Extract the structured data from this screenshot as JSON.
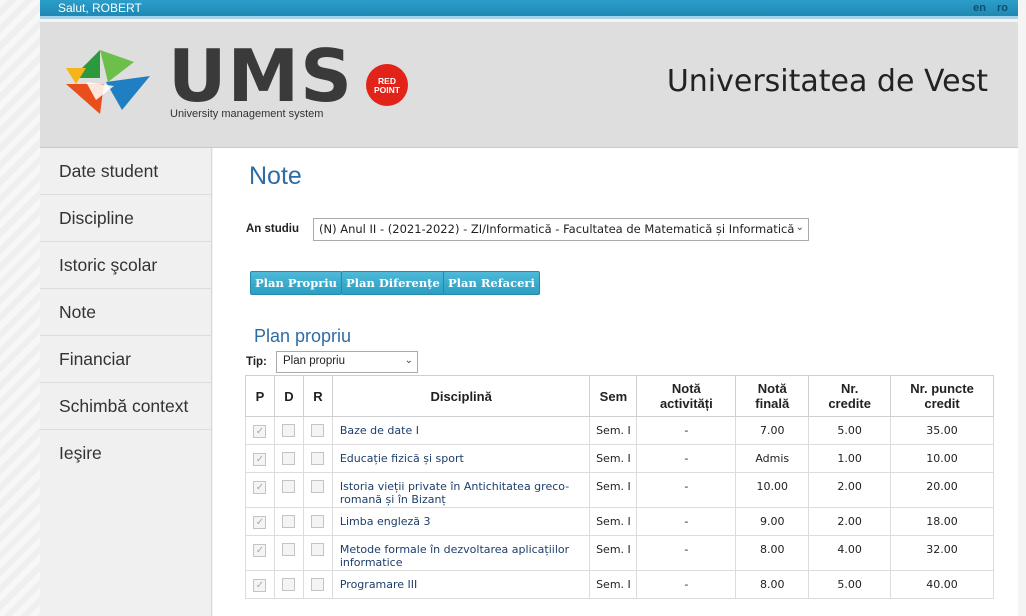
{
  "topbar": {
    "greeting": "Salut, ROBERT",
    "lang_en": "en",
    "lang_ro": "ro"
  },
  "header": {
    "logo_text": "UMS",
    "logo_subtitle": "University management system",
    "badge_line1": "RED",
    "badge_line2": "POINT",
    "university": "Universitatea de Vest"
  },
  "sidebar": {
    "items": [
      {
        "label": "Date student"
      },
      {
        "label": "Discipline"
      },
      {
        "label": "Istoric şcolar"
      },
      {
        "label": "Note"
      },
      {
        "label": "Financiar"
      },
      {
        "label": "Schimbă context"
      },
      {
        "label": "Ieşire"
      }
    ]
  },
  "main": {
    "title": "Note",
    "year_label": "An studiu",
    "year_value": "(N) Anul II - (2021-2022) - ZI/Informatică - Facultatea de Matematică și Informatică",
    "buttons": {
      "plan_propriu": "Plan Propriu",
      "plan_diferente": "Plan Diferențe",
      "plan_refaceri": "Plan Refaceri"
    },
    "section_title": "Plan propriu",
    "tip_label": "Tip:",
    "tip_value": "Plan propriu",
    "table": {
      "headers": {
        "p": "P",
        "d": "D",
        "r": "R",
        "disciplina": "Disciplină",
        "sem": "Sem",
        "nota_activitati_1": "Notă",
        "nota_activitati_2": "activități",
        "nota_finala_1": "Notă",
        "nota_finala_2": "finală",
        "credite_1": "Nr.",
        "credite_2": "credite",
        "puncte_1": "Nr. puncte",
        "puncte_2": "credit"
      },
      "rows": [
        {
          "disciplina": "Baze de date I",
          "sem": "Sem. I",
          "nota_activitati": "-",
          "nota_finala": "7.00",
          "credite": "5.00",
          "puncte": "35.00",
          "p": true
        },
        {
          "disciplina": "Educație fizică și sport",
          "sem": "Sem. I",
          "nota_activitati": "-",
          "nota_finala": "Admis",
          "credite": "1.00",
          "puncte": "10.00",
          "p": true
        },
        {
          "disciplina": "Istoria vieții private în Antichitatea greco-romană și în Bizanț",
          "sem": "Sem. I",
          "nota_activitati": "-",
          "nota_finala": "10.00",
          "credite": "2.00",
          "puncte": "20.00",
          "p": true
        },
        {
          "disciplina": "Limba engleză 3",
          "sem": "Sem. I",
          "nota_activitati": "-",
          "nota_finala": "9.00",
          "credite": "2.00",
          "puncte": "18.00",
          "p": true
        },
        {
          "disciplina": "Metode formale în dezvoltarea aplicațiilor informatice",
          "sem": "Sem. I",
          "nota_activitati": "-",
          "nota_finala": "8.00",
          "credite": "4.00",
          "puncte": "32.00",
          "p": true
        },
        {
          "disciplina": "Programare III",
          "sem": "Sem. I",
          "nota_activitati": "-",
          "nota_finala": "8.00",
          "credite": "5.00",
          "puncte": "40.00",
          "p": true
        }
      ]
    }
  },
  "colors": {
    "accent": "#2e6ca6",
    "topbar": "#1f88b3",
    "button": "#2a9fc3",
    "badge": "#e2231a"
  }
}
